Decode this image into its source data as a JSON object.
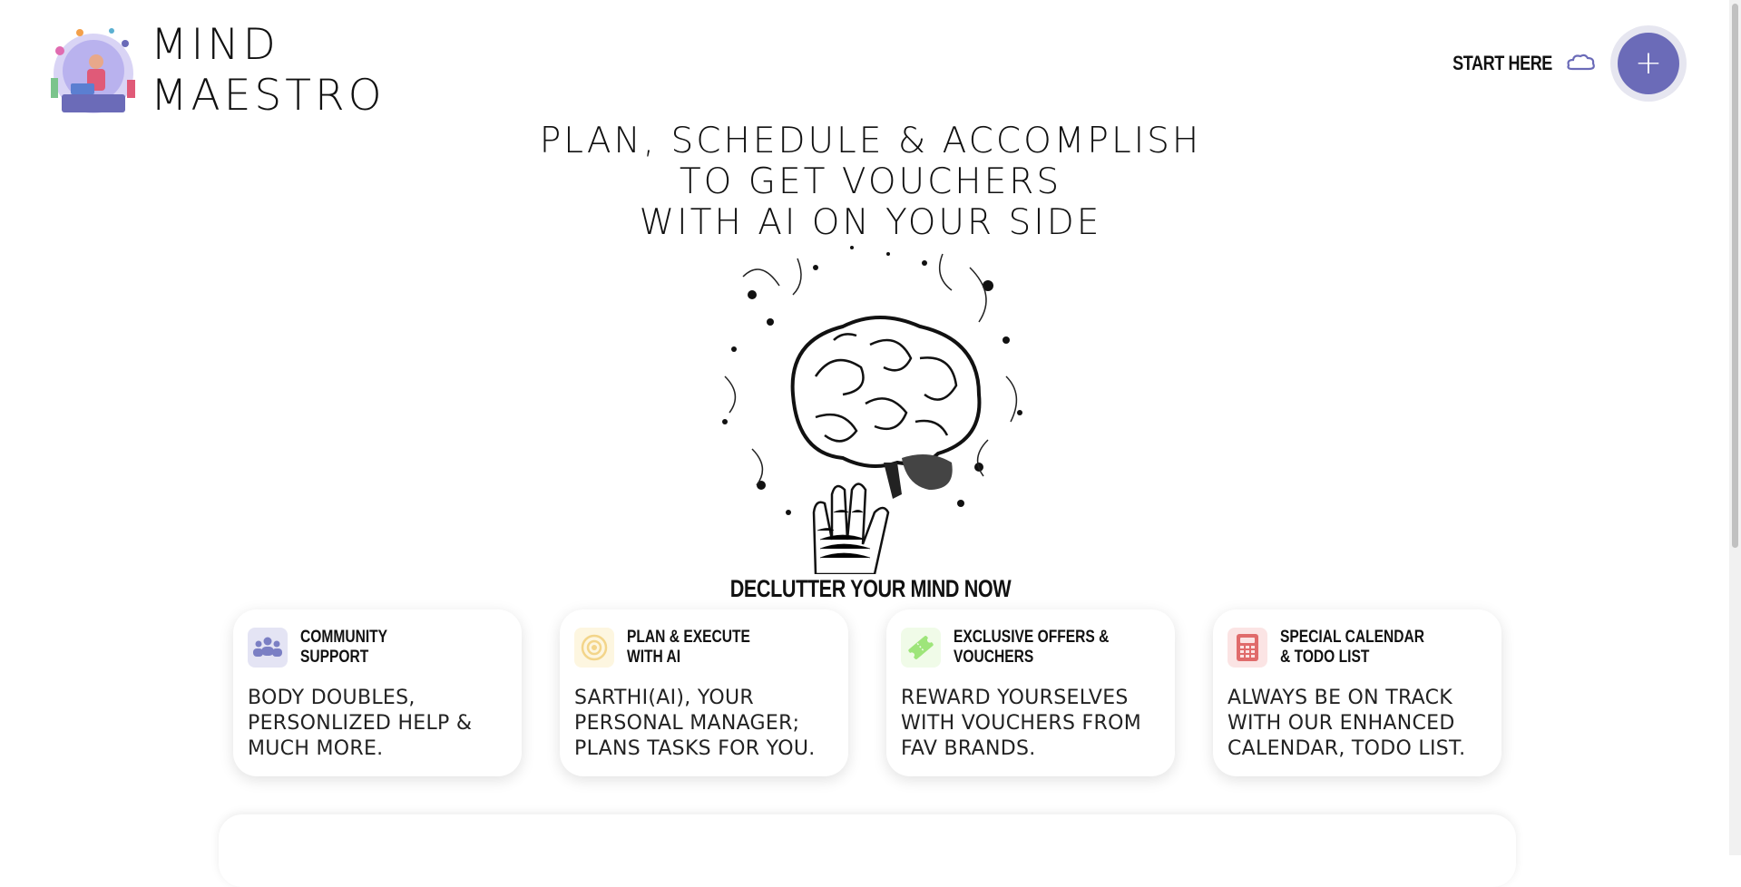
{
  "brand": {
    "line1": "MIND",
    "line2": "MAESTRO"
  },
  "nav": {
    "start_label": "START HERE",
    "plus_label": "+"
  },
  "hero": {
    "line1": "PLAN, SCHEDULE & ACCOMPLISH",
    "line2": "TO GET VOUCHERS",
    "line3": "WITH AI ON YOUR SIDE",
    "cta": "DECLUTTER YOUR MIND NOW"
  },
  "features": [
    {
      "icon": "community-icon",
      "title1": "COMMUNITY",
      "title2": "SUPPORT",
      "desc": "BODY DOUBLES,\nPERSONLIZED HELP &\nMUCH MORE.",
      "color": "#7b7fc4"
    },
    {
      "icon": "target-icon",
      "title1": "PLAN & EXECUTE",
      "title2": "WITH AI",
      "desc": "SARTHI(AI), YOUR\nPERSONAL MANAGER;\nPLANS TASKS FOR YOU.",
      "color": "#f3d58a"
    },
    {
      "icon": "ticket-icon",
      "title1": "EXCLUSIVE OFFERS &",
      "title2": "VOUCHERS",
      "desc": "REWARD YOURSELVES\nWITH VOUCHERS FROM\nFAV BRANDS.",
      "color": "#9ee57a"
    },
    {
      "icon": "calculator-icon",
      "title1": "SPECIAL CALENDAR",
      "title2": "& TODO LIST",
      "desc": "ALWAYS BE ON TRACK\nWITH OUR ENHANCED\nCALENDAR, TODO LIST.",
      "color": "#e06b6b"
    }
  ],
  "colors": {
    "accent": "#6b6bb8",
    "background": "#ffffff"
  }
}
